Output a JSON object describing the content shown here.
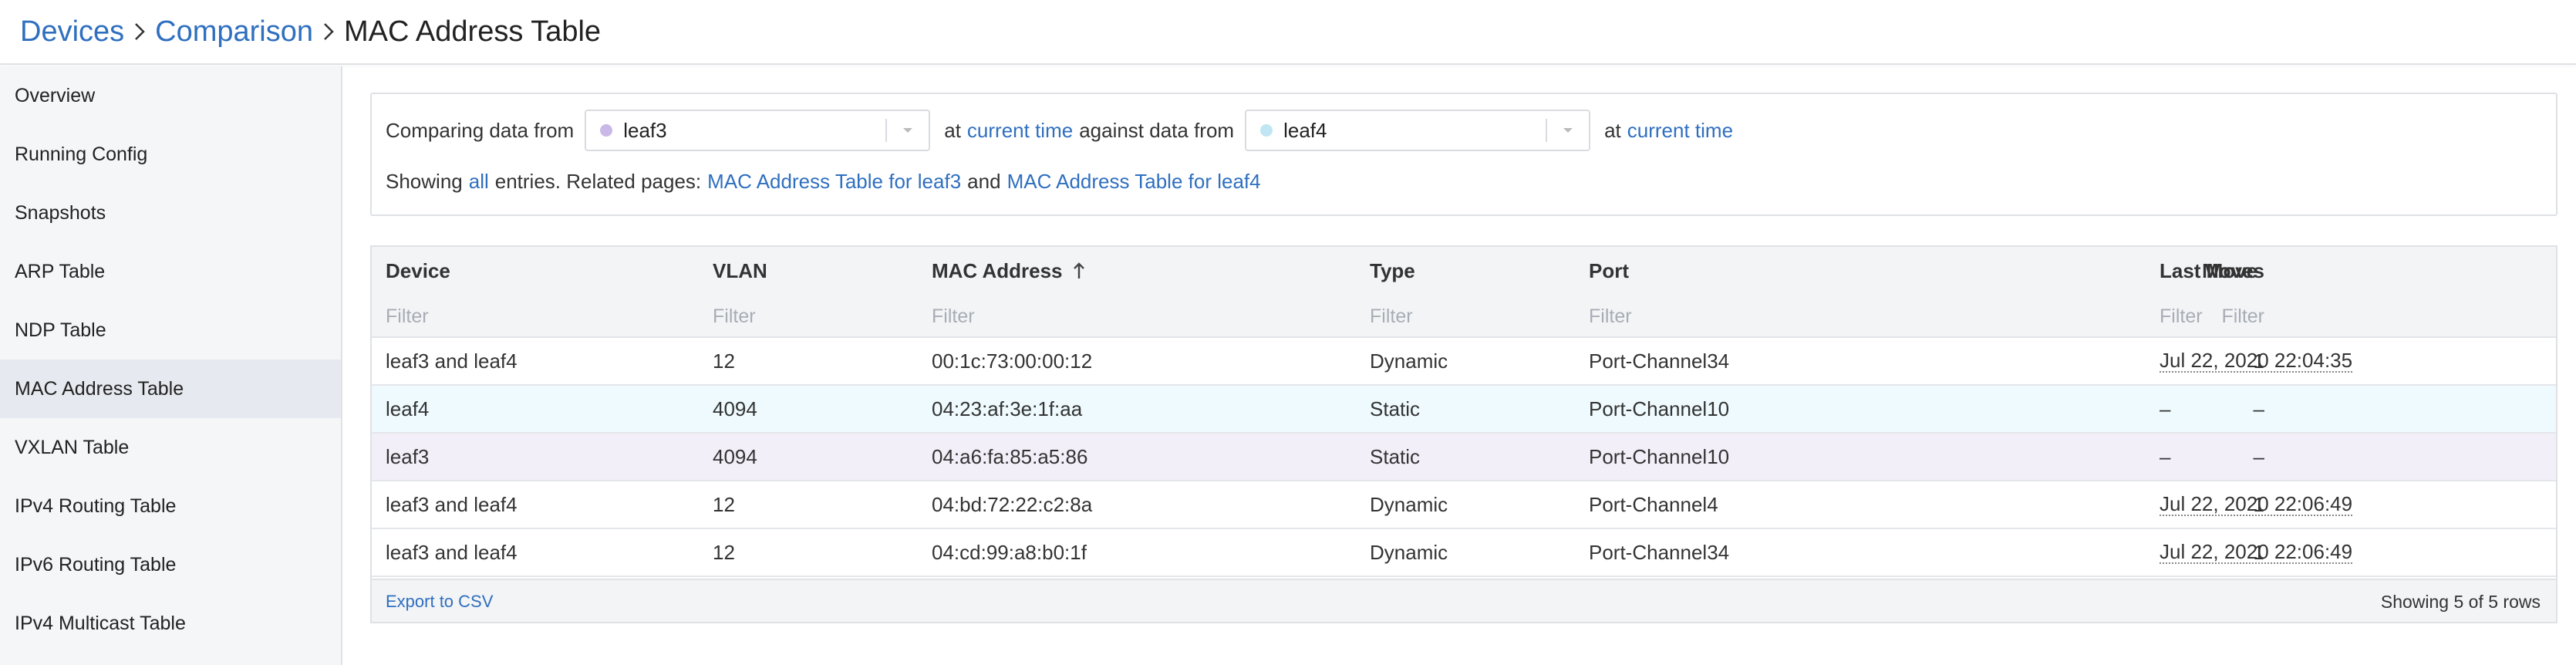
{
  "breadcrumb": {
    "items": [
      "Devices",
      "Comparison"
    ],
    "current": "MAC Address Table"
  },
  "sidebar": {
    "items": [
      {
        "label": "Overview"
      },
      {
        "label": "Running Config"
      },
      {
        "label": "Snapshots"
      },
      {
        "label": "ARP Table"
      },
      {
        "label": "NDP Table"
      },
      {
        "label": "MAC Address Table",
        "active": true
      },
      {
        "label": "VXLAN Table"
      },
      {
        "label": "IPv4 Routing Table"
      },
      {
        "label": "IPv6 Routing Table"
      },
      {
        "label": "IPv4 Multicast Table"
      }
    ]
  },
  "compare": {
    "prefix": "Comparing data from",
    "left_device": "leaf3",
    "left_dot_color": "#c9b8e8",
    "at1": "at",
    "time1": "current time",
    "against": "against data from",
    "right_device": "leaf4",
    "right_dot_color": "#bfe6f2",
    "at2": "at",
    "time2": "current time",
    "showing": "Showing",
    "all": "all",
    "entries": "entries. Related pages:",
    "related1": "MAC Address Table for leaf3",
    "and": "and",
    "related2": "MAC Address Table for leaf4"
  },
  "table": {
    "columns": {
      "device": "Device",
      "vlan": "VLAN",
      "mac": "MAC Address",
      "type": "Type",
      "port": "Port",
      "moves": "Moves",
      "last_move": "Last Move"
    },
    "filter_placeholder": "Filter",
    "rows": [
      {
        "device": "leaf3 and leaf4",
        "vlan": "12",
        "mac": "00:1c:73:00:00:12",
        "type": "Dynamic",
        "port": "Port-Channel34",
        "moves": "1",
        "last_move": "Jul 22, 2020 22:04:35",
        "highlight": ""
      },
      {
        "device": "leaf4",
        "vlan": "4094",
        "mac": "04:23:af:3e:1f:aa",
        "type": "Static",
        "port": "Port-Channel10",
        "moves": "–",
        "last_move": "–",
        "highlight": "#eefafd"
      },
      {
        "device": "leaf3",
        "vlan": "4094",
        "mac": "04:a6:fa:85:a5:86",
        "type": "Static",
        "port": "Port-Channel10",
        "moves": "–",
        "last_move": "–",
        "highlight": "#f3eff9"
      },
      {
        "device": "leaf3 and leaf4",
        "vlan": "12",
        "mac": "04:bd:72:22:c2:8a",
        "type": "Dynamic",
        "port": "Port-Channel4",
        "moves": "1",
        "last_move": "Jul 22, 2020 22:06:49",
        "highlight": ""
      },
      {
        "device": "leaf3 and leaf4",
        "vlan": "12",
        "mac": "04:cd:99:a8:b0:1f",
        "type": "Dynamic",
        "port": "Port-Channel34",
        "moves": "1",
        "last_move": "Jul 22, 2020 22:06:49",
        "highlight": ""
      }
    ],
    "export_label": "Export to CSV",
    "row_count": "Showing 5 of 5 rows"
  }
}
